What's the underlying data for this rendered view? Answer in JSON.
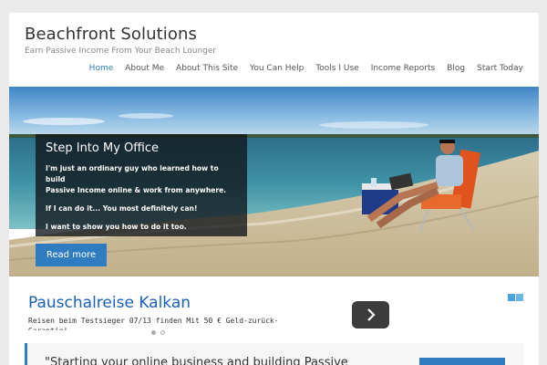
{
  "site": {
    "title": "Beachfront Solutions",
    "tagline": "Earn Passive Income From Your Beach Lounger"
  },
  "nav": {
    "items": [
      {
        "label": "Home",
        "active": true
      },
      {
        "label": "About Me"
      },
      {
        "label": "About This Site"
      },
      {
        "label": "You Can Help"
      },
      {
        "label": "Tools I Use"
      },
      {
        "label": "Income Reports"
      },
      {
        "label": "Blog"
      },
      {
        "label": "Start Today"
      }
    ]
  },
  "hero": {
    "caption_title": "Step Into My Office",
    "line1": "I'm just an ordinary guy who learned how to build",
    "line2": "Passive Income online & work from anywhere.",
    "line3": "If I can do it... You most definitely can!",
    "line4": "I want to show you how to do it too.",
    "read_more": "Read more"
  },
  "ad": {
    "title": "Pauschalreise Kalkan",
    "description": "Reisen beim Testsieger 07/13 finden Mit 50 € Geld-zurück-",
    "description_cont": "Garantie!"
  },
  "quote": {
    "text": "\"Starting your online business and building Passive"
  },
  "colors": {
    "accent": "#2f7cc1",
    "ad_link": "#1a5fb4",
    "caption_bg": "#0f1419"
  }
}
